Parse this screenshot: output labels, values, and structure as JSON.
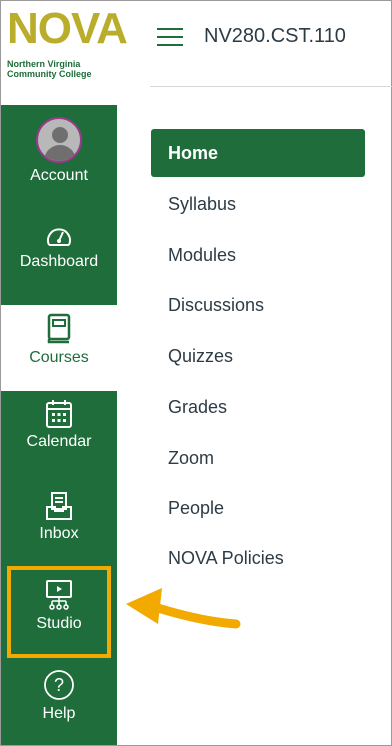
{
  "logo": {
    "word": "NOVA",
    "line1": "Northern Virginia",
    "line2": "Community College"
  },
  "global_nav": {
    "account": "Account",
    "dashboard": "Dashboard",
    "courses": "Courses",
    "calendar": "Calendar",
    "inbox": "Inbox",
    "studio": "Studio",
    "help": "Help",
    "help_glyph": "?"
  },
  "header": {
    "course_title": "NV280.CST.110"
  },
  "course_nav": [
    "Home",
    "Syllabus",
    "Modules",
    "Discussions",
    "Quizzes",
    "Grades",
    "Zoom",
    "People",
    "NOVA Policies"
  ],
  "colors": {
    "brand_green": "#1e6d3a",
    "logo_gold": "#b9ad2b",
    "highlight": "#f2a900"
  }
}
